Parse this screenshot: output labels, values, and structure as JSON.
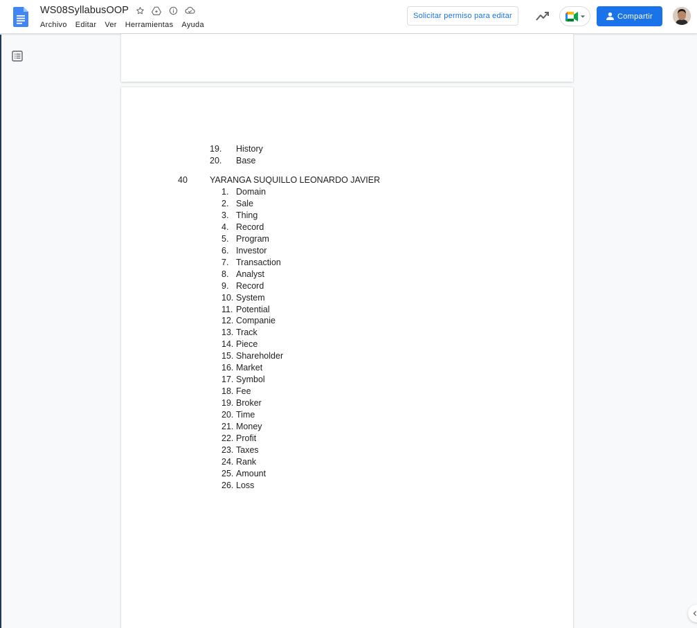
{
  "header": {
    "doc_title": "WS08SyllabusOOP",
    "menu": [
      "Archivo",
      "Editar",
      "Ver",
      "Herramientas",
      "Ayuda"
    ],
    "request_edit_label": "Solicitar permiso para editar",
    "share_label": "Compartir",
    "icons": {
      "logo": "google-docs-logo-icon",
      "star": "star-icon",
      "move": "move-to-drive-icon",
      "info": "info-icon",
      "cloud": "cloud-status-icon",
      "activity": "activity-trend-icon",
      "meet": "google-meet-icon",
      "share": "person-add-icon",
      "outline": "document-outline-icon"
    },
    "colors": {
      "accent": "#1a73e8",
      "docs_blue": "#4285f4"
    }
  },
  "document": {
    "previous_items": [
      {
        "num": "19.",
        "text": "History",
        "struck": false
      },
      {
        "num": "20.",
        "text": "Base",
        "struck": true
      }
    ],
    "student": {
      "number": "40",
      "name": "YARANGA SUQUILLO LEONARDO JAVIER"
    },
    "items": [
      {
        "num": "1.",
        "text": "Domain",
        "struck": false
      },
      {
        "num": "2.",
        "text": "Sale",
        "struck": false
      },
      {
        "num": "3.",
        "text": "Thing",
        "struck": false
      },
      {
        "num": "4.",
        "text": "Record",
        "struck": false
      },
      {
        "num": "5.",
        "text": "Program",
        "struck": false
      },
      {
        "num": "6.",
        "text": "Investor",
        "struck": false
      },
      {
        "num": "7.",
        "text": "Transaction",
        "struck": true
      },
      {
        "num": "8.",
        "text": "Analyst",
        "struck": false
      },
      {
        "num": "9.",
        "text": "Record",
        "struck": false
      },
      {
        "num": "10.",
        "text": "System",
        "struck": false
      },
      {
        "num": "11.",
        "text": "Potential",
        "struck": true
      },
      {
        "num": "12.",
        "text": "Companie",
        "struck": false
      },
      {
        "num": "13.",
        "text": "Track",
        "struck": true
      },
      {
        "num": "14.",
        "text": "Piece",
        "struck": false
      },
      {
        "num": "15.",
        "text": "Shareholder",
        "struck": false
      },
      {
        "num": "16.",
        "text": "Market",
        "struck": false
      },
      {
        "num": "17.",
        "text": "Symbol",
        "struck": true
      },
      {
        "num": "18.",
        "text": "Fee",
        "struck": true
      },
      {
        "num": "19.",
        "text": "Broker",
        "struck": false
      },
      {
        "num": "20.",
        "text": "Time",
        "struck": true
      },
      {
        "num": "21.",
        "text": "Money",
        "struck": true
      },
      {
        "num": "22.",
        "text": "Profit",
        "struck": true
      },
      {
        "num": "23.",
        "text": "Taxes",
        "struck": true
      },
      {
        "num": "24.",
        "text": "Rank",
        "struck": true
      },
      {
        "num": "25.",
        "text": "Amount",
        "struck": true
      },
      {
        "num": "26.",
        "text": "Loss",
        "struck": true
      }
    ]
  }
}
